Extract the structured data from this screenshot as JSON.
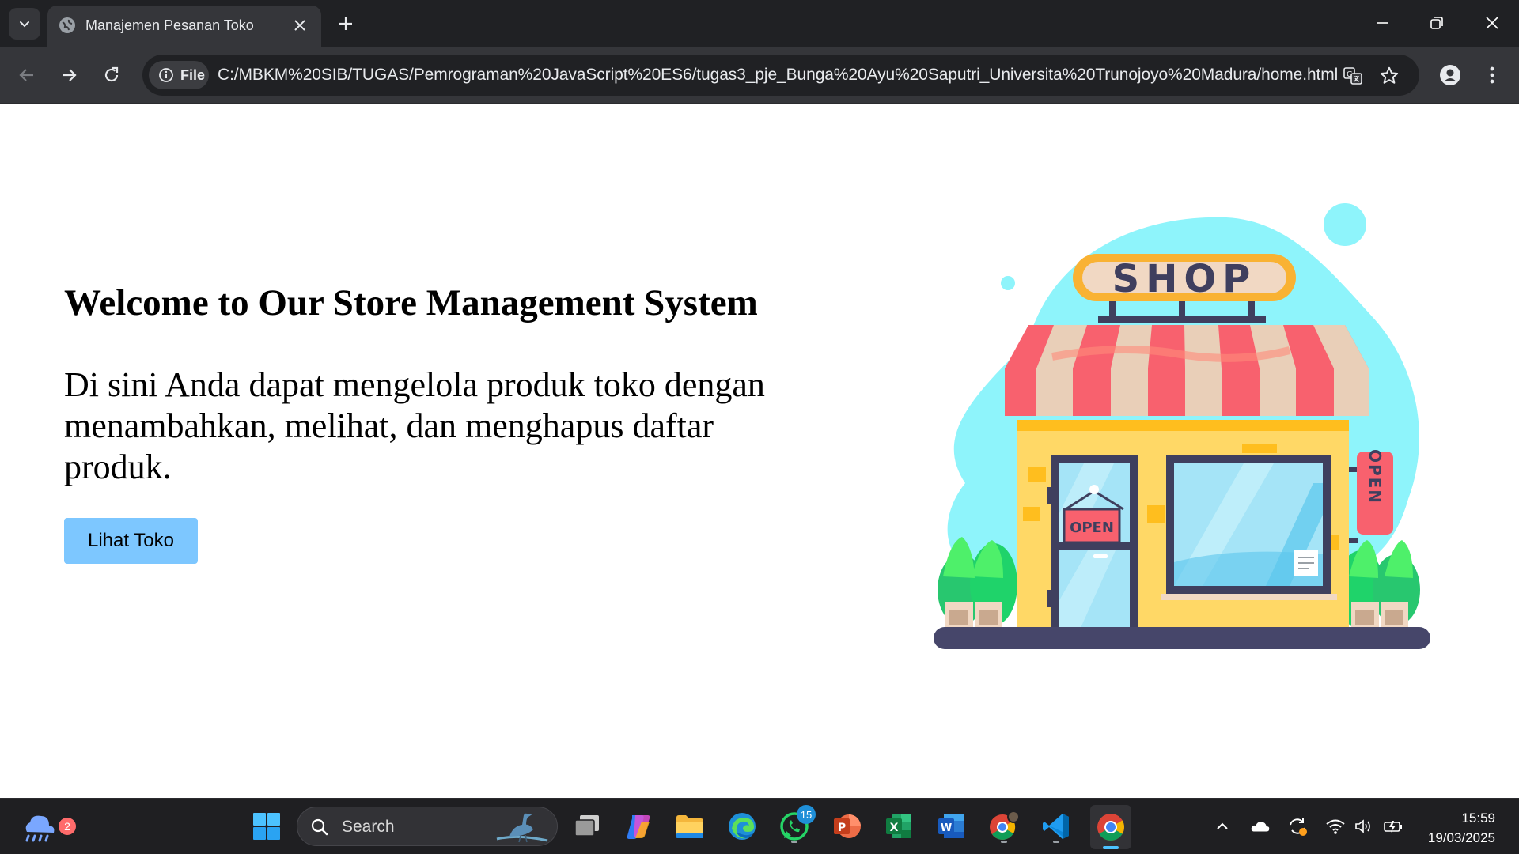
{
  "browser": {
    "tab_title": "Manajemen Pesanan Toko",
    "address_chip": "File",
    "url": "C:/MBKM%20SIB/TUGAS/Pemrograman%20JavaScript%20ES6/tugas3_pje_Bunga%20Ayu%20Saputri_Universita%20Trunojoyo%20Madura/home.html"
  },
  "page": {
    "title": "Welcome to Our Store Management System",
    "description": "Di sini Anda dapat mengelola produk toko dengan menambahkan, melihat, dan menghapus daftar produk.",
    "cta_label": "Lihat Toko",
    "illustration": {
      "sign_text": "SHOP",
      "door_sign_text": "OPEN",
      "side_sign_text": "OPEN"
    }
  },
  "taskbar": {
    "weather_badge": "2",
    "search_label": "Search",
    "whatsapp_badge": "15",
    "apps": [
      "start-icon",
      "search-icon",
      "task-view-icon",
      "copilot-icon",
      "file-explorer-icon",
      "edge-icon",
      "whatsapp-icon",
      "powerpoint-icon",
      "excel-icon",
      "word-icon",
      "chrome-profile-icon",
      "vscode-icon",
      "chrome-icon"
    ],
    "clock": {
      "time": "15:59",
      "date": "19/03/2025"
    }
  },
  "colors": {
    "button_bg": "#7dc7ff",
    "blob": "#8ef4fb",
    "awning_red": "#f8616e",
    "awning_cream": "#e9cfb8",
    "wall": "#ffd866",
    "frame": "#3f3f5e"
  }
}
